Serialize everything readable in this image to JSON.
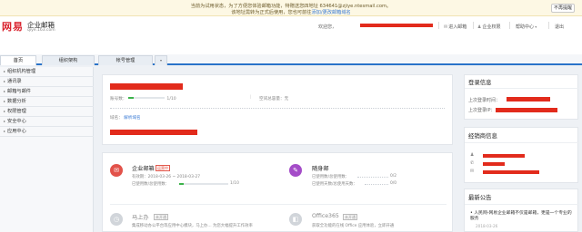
{
  "notice": {
    "line1": "当前为试用状态，为了方便您体验邮箱功能，特赠送您四地址 634641@zjiye.ntesmail.com。",
    "line2_text": "该地址需转为正式后使用，您也可前往",
    "line2_link": "添加/更改邮箱域名",
    "dismiss_label": "不再提醒"
  },
  "header": {
    "brand": "网易",
    "product_name": "企业邮箱",
    "domain": "qiye.163.com",
    "welcome": "欢迎您，",
    "links": {
      "enter_mail": "进入邮箱",
      "enterprise_rights": "企业权限",
      "help_center": "帮助中心",
      "exit": "退出"
    }
  },
  "tabs": [
    {
      "label": "首页"
    },
    {
      "label": "组织架构"
    },
    {
      "label": "帐号管理"
    },
    {
      "label": "▾"
    }
  ],
  "sidebar": {
    "items": [
      {
        "label": "组织机构管理"
      },
      {
        "label": "通讯录"
      },
      {
        "label": "邮箱与邮件"
      },
      {
        "label": "数据分析"
      },
      {
        "label": "权限管理"
      },
      {
        "label": "安全中心"
      },
      {
        "label": "应用中心"
      }
    ]
  },
  "overview": {
    "account_label": "账号数：",
    "account_value": "1/10",
    "space_label": "空间总容量：",
    "space_value": "无",
    "domain_label": "域名：",
    "domain_action": "解析域名"
  },
  "services": {
    "mail": {
      "title": "企业邮箱",
      "badge": "运营中",
      "validity": "有效期：2018-03-26 ~ 2018-03-27",
      "usage_label": "已使用数/总使用数：",
      "usage_value": "1/10",
      "usage_progress": 0.1
    },
    "suishou": {
      "title": "随身邮",
      "usage_label": "已使用数/总使用数：",
      "usage_value": "0/2",
      "period_label": "已使用天数/总使用天数：",
      "period_value": "0/0"
    },
    "mashangban": {
      "title": "马上办",
      "badge": "未开通",
      "desc": "集成移动办公平台等应用中心模块，马上办... 为您大幅提升工作效率"
    },
    "office365": {
      "title": "Office365",
      "badge": "未开通",
      "desc": "获取全功能的在线 Office 应用体验，立即开通"
    }
  },
  "right": {
    "login_title": "登录信息",
    "last_login_time": "上次登录时间：",
    "last_login_ip": "上次登录IP：",
    "dealer_title": "经销商信息",
    "announce_title": "最新公告",
    "news_text": "人民网-网易企业邮箱不仅是邮箱，更是一个专业的服务",
    "news_date": "2018-03-26"
  },
  "colors": {
    "accent": "#2a73c9",
    "redact": "#e22b1c",
    "progress": "#3cb34a",
    "mail_icon": "#e2524a",
    "suishou_icon": "#a44cc8",
    "disabled_icon": "#d1d5da"
  }
}
